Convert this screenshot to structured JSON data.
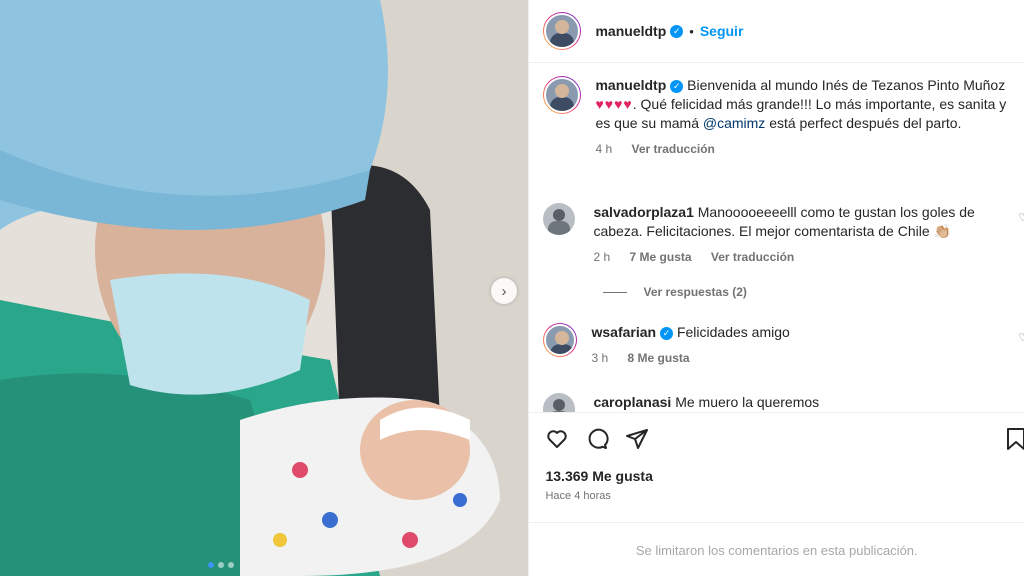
{
  "post": {
    "username": "manueldtp",
    "follow_label": "Seguir",
    "separator": "•"
  },
  "caption": {
    "username": "manueldtp",
    "text_1": "Bienvenida al mundo Inés de Tezanos Pinto Muñoz",
    "hearts": "♥♥♥♥",
    "text_2": ". Qué felicidad más grande!!! Lo más importante, es sanita y es que su mamá",
    "mention": "@camimz",
    "text_3": "está perfect después del parto.",
    "time": "4 h",
    "translate": "Ver traducción"
  },
  "comments": [
    {
      "username": "salvadorplaza1",
      "text": "Manooooeeeelll como te gustan los goles de cabeza. Felicitaciones. El mejor comentarista de Chile 👏🏼",
      "time": "2 h",
      "likes": "7 Me gusta",
      "translate": "Ver traducción",
      "replies": "Ver respuestas (2)"
    },
    {
      "username": "wsafarian",
      "text": "Felicidades amigo",
      "time": "3 h",
      "likes": "8 Me gusta"
    },
    {
      "username": "caroplanasi",
      "text": "Me muero la queremos"
    }
  ],
  "stats": {
    "likes": "13.369 Me gusta",
    "posted": "Hace 4 horas"
  },
  "footer": {
    "notice": "Se limitaron los comentarios en esta publicación."
  },
  "icons": {
    "next": "chevron-right-icon",
    "like": "heart-icon",
    "comment": "comment-icon",
    "share": "share-icon",
    "save": "bookmark-icon"
  },
  "colors": {
    "accent": "#0095f6",
    "heart": "#e0245e"
  }
}
